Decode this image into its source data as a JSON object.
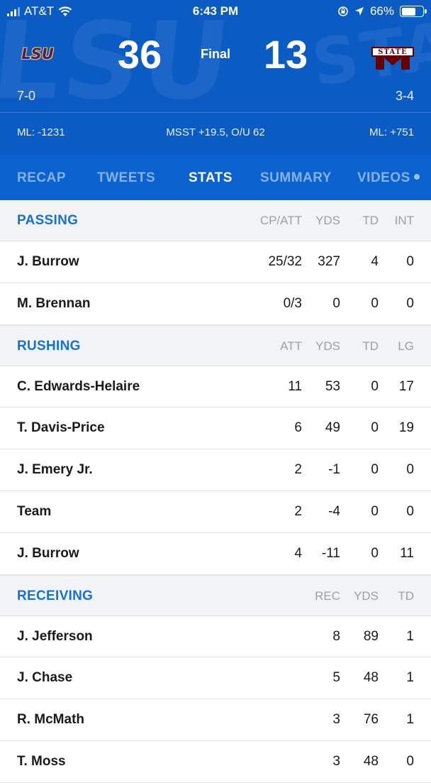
{
  "status_bar": {
    "carrier": "AT&T",
    "time": "6:43 PM",
    "battery": "66%",
    "battery_level": 0.66,
    "icons": [
      "signal-icon",
      "wifi-icon",
      "orientation-lock-icon",
      "location-icon",
      "battery-icon"
    ]
  },
  "game": {
    "home": {
      "logo_text": "LSU",
      "score": "36",
      "record": "7-0",
      "moneyline": "ML: -1231"
    },
    "away": {
      "logo_text": "STATE",
      "score": "13",
      "record": "3-4",
      "moneyline": "ML: +751"
    },
    "status": "Final",
    "line": "MSST +19.5, O/U 62"
  },
  "tabs": [
    {
      "label": "RECAP",
      "active": false
    },
    {
      "label": "TWEETS",
      "active": false
    },
    {
      "label": "STATS",
      "active": true
    },
    {
      "label": "SUMMARY",
      "active": false
    },
    {
      "label": "VIDEOS",
      "active": false
    }
  ],
  "passing": {
    "title": "PASSING",
    "columns": [
      "CP/ATT",
      "YDS",
      "TD",
      "INT"
    ],
    "rows": [
      {
        "player": "J. Burrow",
        "stats": [
          "25/32",
          "327",
          "4",
          "0"
        ]
      },
      {
        "player": "M. Brennan",
        "stats": [
          "0/3",
          "0",
          "0",
          "0"
        ]
      }
    ]
  },
  "rushing": {
    "title": "RUSHING",
    "columns": [
      "ATT",
      "YDS",
      "TD",
      "LG"
    ],
    "rows": [
      {
        "player": "C. Edwards-Helaire",
        "stats": [
          "11",
          "53",
          "0",
          "17"
        ]
      },
      {
        "player": "T. Davis-Price",
        "stats": [
          "6",
          "49",
          "0",
          "19"
        ]
      },
      {
        "player": "J. Emery Jr.",
        "stats": [
          "2",
          "-1",
          "0",
          "0"
        ]
      },
      {
        "player": "Team",
        "stats": [
          "2",
          "-4",
          "0",
          "0"
        ]
      },
      {
        "player": "J. Burrow",
        "stats": [
          "4",
          "-11",
          "0",
          "11"
        ]
      }
    ]
  },
  "receiving": {
    "title": "RECEIVING",
    "columns": [
      "REC",
      "YDS",
      "TD"
    ],
    "rows": [
      {
        "player": "J. Jefferson",
        "stats": [
          "8",
          "89",
          "1"
        ]
      },
      {
        "player": "J. Chase",
        "stats": [
          "5",
          "48",
          "1"
        ]
      },
      {
        "player": "R. McMath",
        "stats": [
          "3",
          "76",
          "1"
        ]
      },
      {
        "player": "T. Moss",
        "stats": [
          "3",
          "48",
          "0"
        ]
      }
    ]
  },
  "colors": {
    "header_bg": "#0a5bc4",
    "accent": "#1670d6",
    "section_bg": "#f2f3f5"
  }
}
